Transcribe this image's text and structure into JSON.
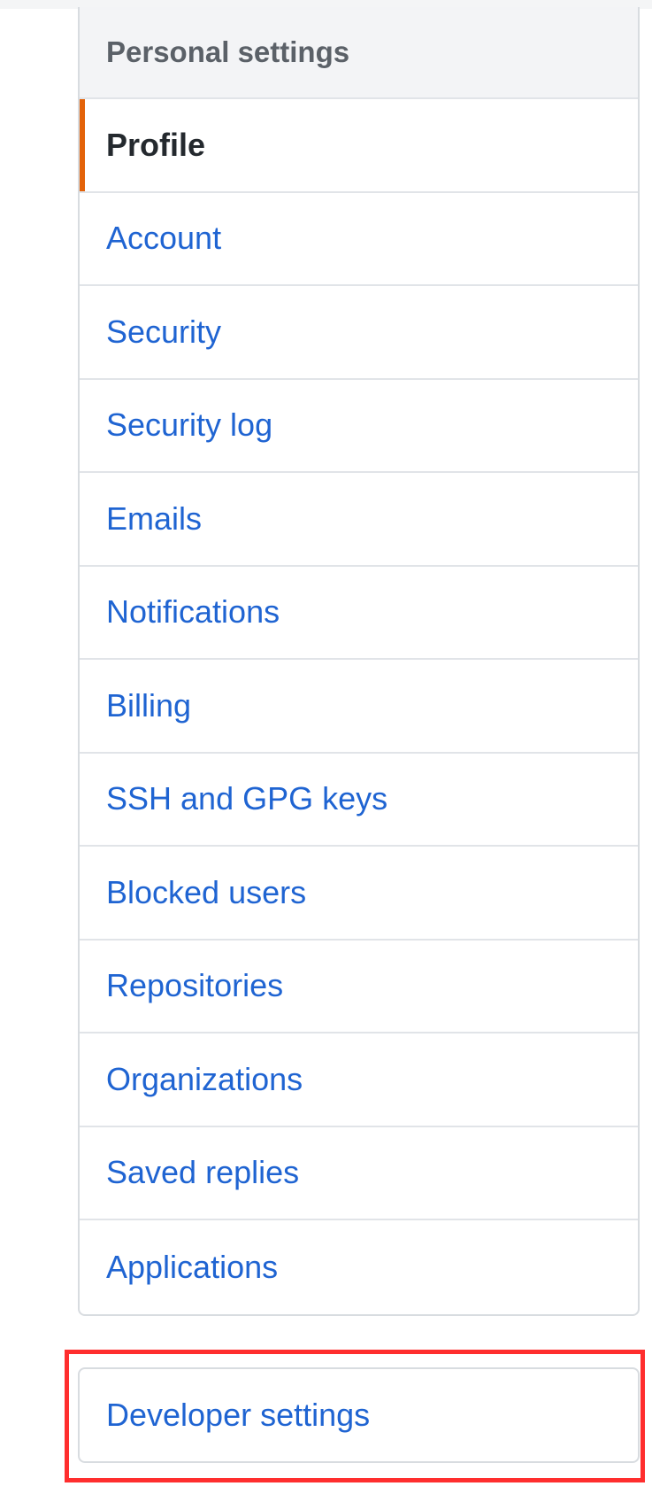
{
  "settings_menu": {
    "heading": "Personal settings",
    "items": [
      {
        "label": "Profile",
        "selected": true
      },
      {
        "label": "Account"
      },
      {
        "label": "Security"
      },
      {
        "label": "Security log"
      },
      {
        "label": "Emails"
      },
      {
        "label": "Notifications"
      },
      {
        "label": "Billing"
      },
      {
        "label": "SSH and GPG keys"
      },
      {
        "label": "Blocked users"
      },
      {
        "label": "Repositories"
      },
      {
        "label": "Organizations"
      },
      {
        "label": "Saved replies"
      },
      {
        "label": "Applications"
      }
    ]
  },
  "developer_menu": {
    "label": "Developer settings"
  },
  "colors": {
    "link": "#1f64d2",
    "selected_text": "#24292e",
    "selected_accent": "#e36209",
    "heading_text": "#5b6168",
    "heading_bg": "#f3f4f6",
    "border": "#e1e4e8",
    "highlight": "#ff2e2e"
  }
}
